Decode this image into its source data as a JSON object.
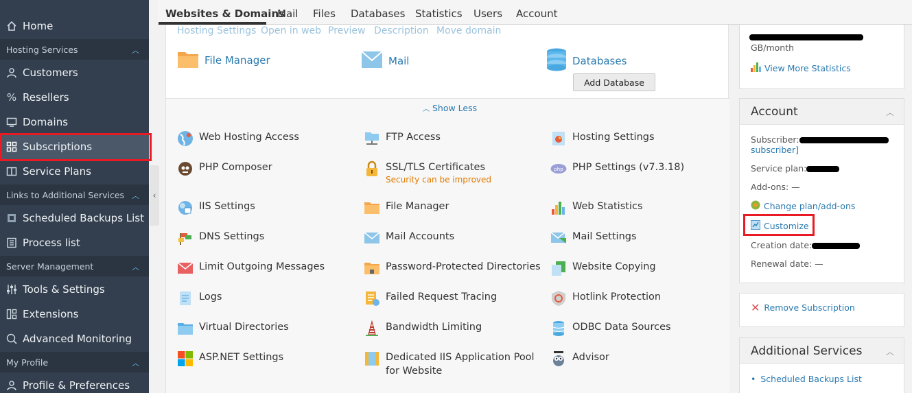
{
  "sidebar": {
    "home": "Home",
    "groups": {
      "hosting_services": "Hosting Services",
      "links_additional": "Links to Additional Services",
      "server_management": "Server Management",
      "my_profile": "My Profile"
    },
    "items": {
      "customers": "Customers",
      "resellers": "Resellers",
      "domains": "Domains",
      "subscriptions": "Subscriptions",
      "service_plans": "Service Plans",
      "scheduled_backups": "Scheduled Backups List",
      "process_list": "Process list",
      "tools_settings": "Tools & Settings",
      "extensions": "Extensions",
      "advanced_monitoring": "Advanced Monitoring",
      "profile_preferences": "Profile & Preferences"
    }
  },
  "topnav": [
    "Websites & Domains",
    "Mail",
    "Files",
    "Databases",
    "Statistics",
    "Users",
    "Account"
  ],
  "main": {
    "sublinks": [
      "Hosting Settings",
      "Open in web",
      "Preview",
      "Description",
      "Move domain"
    ],
    "apps": {
      "file_manager": "File Manager",
      "mail": "Mail",
      "databases": "Databases"
    },
    "add_database": "Add Database",
    "show_less": "Show Less",
    "tools": {
      "web_hosting_access": "Web Hosting Access",
      "ftp_access": "FTP Access",
      "hosting_settings": "Hosting Settings",
      "php_composer": "PHP Composer",
      "ssl_tls": "SSL/TLS Certificates",
      "ssl_warning": "Security can be improved",
      "php_settings": "PHP Settings (v7.3.18)",
      "iis_settings": "IIS Settings",
      "file_manager": "File Manager",
      "web_statistics": "Web Statistics",
      "dns_settings": "DNS Settings",
      "mail_accounts": "Mail Accounts",
      "mail_settings": "Mail Settings",
      "limit_outgoing": "Limit Outgoing Messages",
      "password_protected": "Password-Protected Directories",
      "website_copying": "Website Copying",
      "logs": "Logs",
      "failed_request": "Failed Request Tracing",
      "hotlink": "Hotlink Protection",
      "virtual_dirs": "Virtual Directories",
      "bandwidth": "Bandwidth Limiting",
      "odbc": "ODBC Data Sources",
      "aspnet": "ASP.NET Settings",
      "iis_app_pool_1": "Dedicated IIS Application Pool",
      "iis_app_pool_2": "for Website",
      "advisor": "Advisor"
    }
  },
  "right": {
    "traffic_unit": "GB/month",
    "view_more_stats": "View More Statistics",
    "account_title": "Account",
    "subscriber_label": "Subscriber:",
    "subscriber_link_tail": "subscriber]",
    "service_plan_label": "Service plan:",
    "addons_label": "Add-ons: —",
    "change_plan": "Change plan/add-ons",
    "customize": "Customize",
    "creation_date_label": "Creation date:",
    "renewal_date_label": "Renewal date: —",
    "remove_subscription": "Remove Subscription",
    "additional_services_title": "Additional Services",
    "scheduled_backups": "Scheduled Backups List"
  }
}
